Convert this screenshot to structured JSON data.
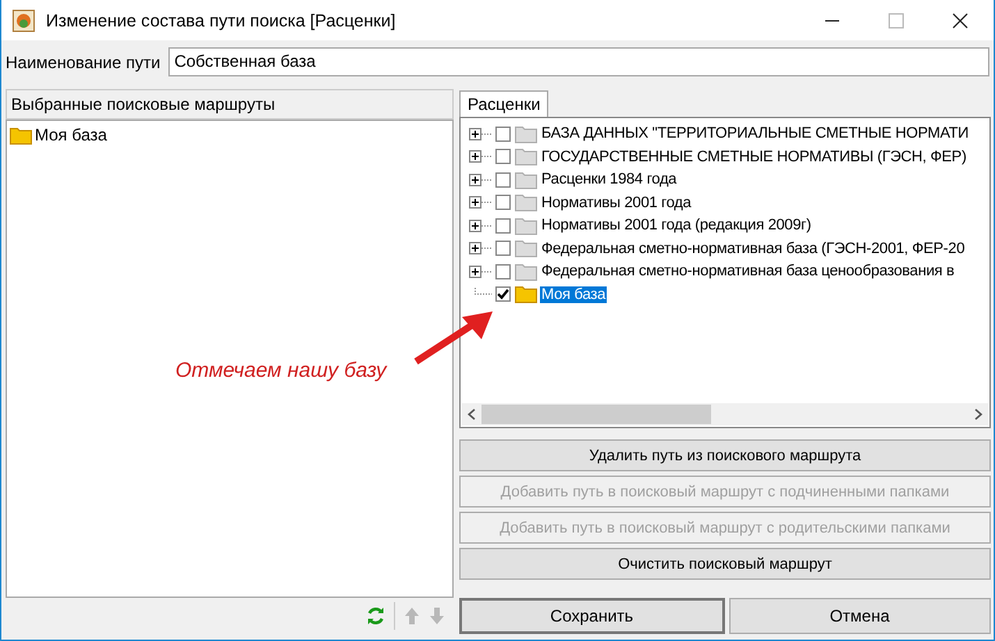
{
  "window": {
    "title": "Изменение состава пути поиска  [Расценки]"
  },
  "path_name": {
    "label": "Наименование пути",
    "value": "Собственная база"
  },
  "left_panel": {
    "header": "Выбранные поисковые маршруты",
    "items": [
      {
        "label": "Моя база",
        "selected": false
      }
    ]
  },
  "tabs": [
    {
      "label": "Расценки",
      "selected": true
    }
  ],
  "tree": [
    {
      "kind": "collapsed",
      "label": "БАЗА ДАННЫХ \"ТЕРРИТОРИАЛЬНЫЕ СМЕТНЫЕ НОРМАТИ",
      "checked": false,
      "selected": false
    },
    {
      "kind": "collapsed",
      "label": "ГОСУДАРСТВЕННЫЕ СМЕТНЫЕ НОРМАТИВЫ (ГЭСН, ФЕР)",
      "checked": false,
      "selected": false
    },
    {
      "kind": "collapsed",
      "label": "Расценки 1984 года",
      "checked": false,
      "selected": false
    },
    {
      "kind": "collapsed",
      "label": "Нормативы 2001 года",
      "checked": false,
      "selected": false
    },
    {
      "kind": "collapsed",
      "label": "Нормативы 2001 года (редакция 2009г)",
      "checked": false,
      "selected": false
    },
    {
      "kind": "collapsed",
      "label": "Федеральная сметно-нормативная база (ГЭСН-2001, ФЕР-20",
      "checked": false,
      "selected": false
    },
    {
      "kind": "collapsed",
      "label": "Федеральная сметно-нормативная база ценообразования в",
      "checked": false,
      "selected": false
    },
    {
      "kind": "leaf",
      "label": "Моя база",
      "checked": true,
      "selected": true
    }
  ],
  "actions": [
    {
      "label": "Удалить путь из поискового маршрута",
      "disabled": false
    },
    {
      "label": "Добавить путь в поисковый маршрут с подчиненными папками",
      "disabled": true
    },
    {
      "label": "Добавить путь в поисковый маршрут с родительскими папками",
      "disabled": true
    },
    {
      "label": "Очистить поисковый маршрут",
      "disabled": false
    }
  ],
  "annotation": {
    "text": "Отмечаем нашу базу"
  },
  "footer": {
    "save": "Сохранить",
    "cancel": "Отмена"
  }
}
